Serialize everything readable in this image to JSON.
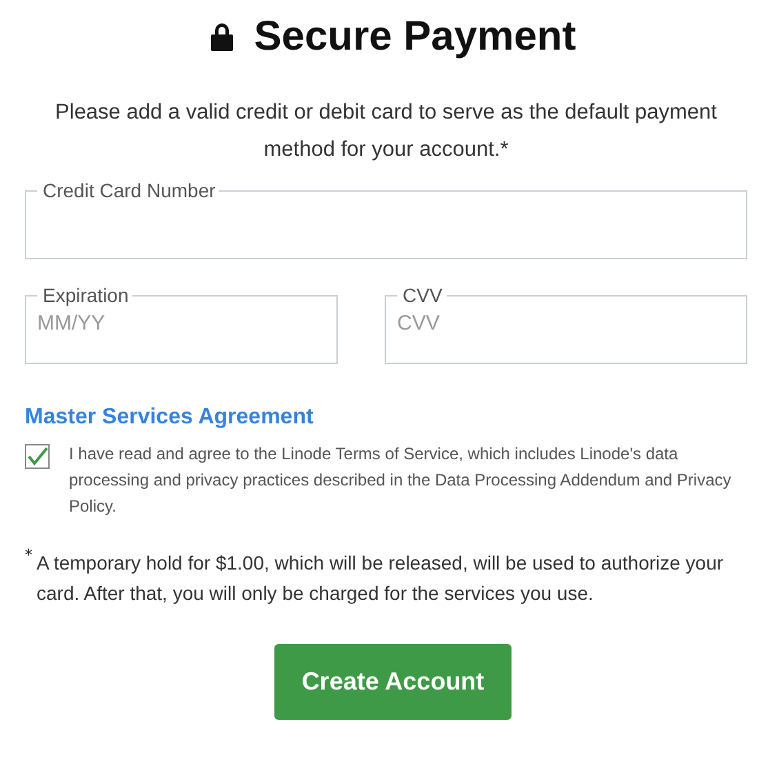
{
  "title": "Secure Payment",
  "intro": "Please add a valid credit or debit card to serve as the default payment method for your account.*",
  "fields": [
    {
      "label": "Credit Card Number"
    },
    {
      "label": "Expiration",
      "placeholder": "MM/YY"
    },
    {
      "label": "CVV",
      "placeholder": "CVV"
    }
  ],
  "agreement": {
    "heading": "Master Services Agreement",
    "checked": true,
    "text": "I have read and agree to the Linode Terms of Service, which includes Linode's data processing and privacy practices described in the Data Processing Addendum and Privacy Policy."
  },
  "footnote": {
    "mark": "*",
    "text": "A temporary hold for $1.00, which will be released, will be used to authorize your card. After that, you will only be charged for the services you use."
  },
  "button": "Create Account"
}
